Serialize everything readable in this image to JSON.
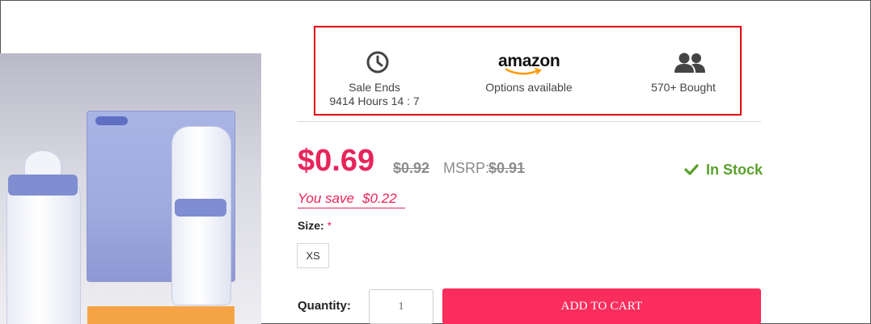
{
  "info_strip": {
    "sale": {
      "label": "Sale Ends",
      "countdown": "9414 Hours 14 : 7",
      "icon": "clock-icon"
    },
    "amazon": {
      "logo_text": "amazon",
      "label": "Options available"
    },
    "bought": {
      "label": "570+ Bought",
      "icon": "people-icon"
    },
    "border_color": "#e3000f"
  },
  "product": {
    "price": "$0.69",
    "old_price": "$0.92",
    "msrp_label": "MSRP:",
    "msrp_value": "$0.91",
    "stock_status": "In Stock",
    "you_save_label": "You save",
    "you_save_value": "$0.22",
    "price_color": "#e8245a",
    "stock_color": "#5aa02c"
  },
  "size": {
    "label": "Size:",
    "required_mark": "*",
    "options": [
      "XS"
    ]
  },
  "quantity": {
    "label": "Quantity:",
    "value": "1"
  },
  "cart_button": {
    "label": "ADD TO CART",
    "color": "#fb2d5c"
  }
}
